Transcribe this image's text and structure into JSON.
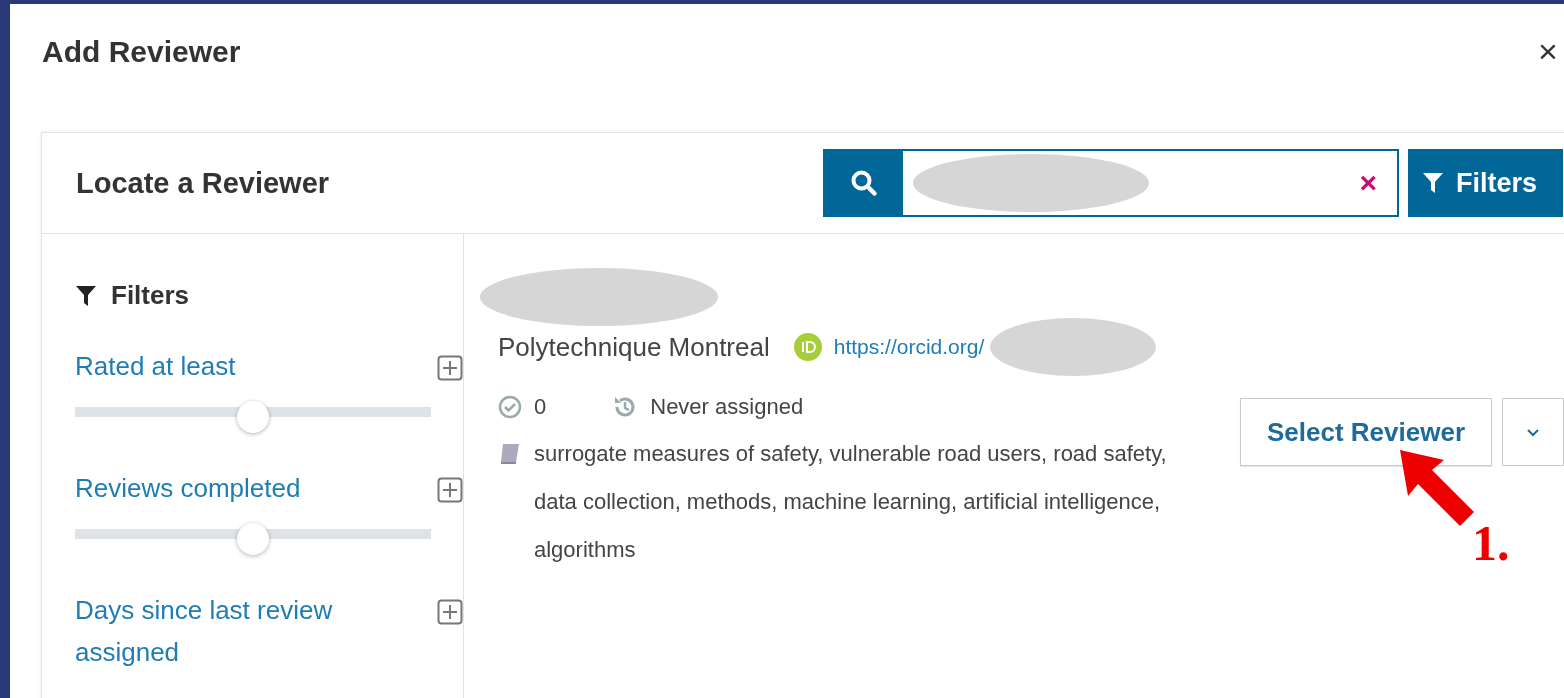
{
  "window": {
    "title": "Add Reviewer",
    "close": "×"
  },
  "panel": {
    "title": "Locate a Reviewer",
    "search": {
      "clear": "×"
    },
    "filters_button": "Filters"
  },
  "filters": {
    "title": "Filters",
    "items": [
      {
        "label": "Rated at least",
        "level": 0.5
      },
      {
        "label": "Reviews completed",
        "level": 0.5
      },
      {
        "label": "Days since last review assigned"
      }
    ]
  },
  "reviewer": {
    "affiliation": "Polytechnique Montreal",
    "orcid": "https://orcid.org/",
    "completed": "0",
    "last_assigned": "Never assigned",
    "interests": "surrogate measures of safety, vulnerable road users, road safety, data collection, methods, machine learning, artificial intelligence, algorithms",
    "select_button": "Select Reviewer"
  },
  "annotation": {
    "label": "1."
  }
}
